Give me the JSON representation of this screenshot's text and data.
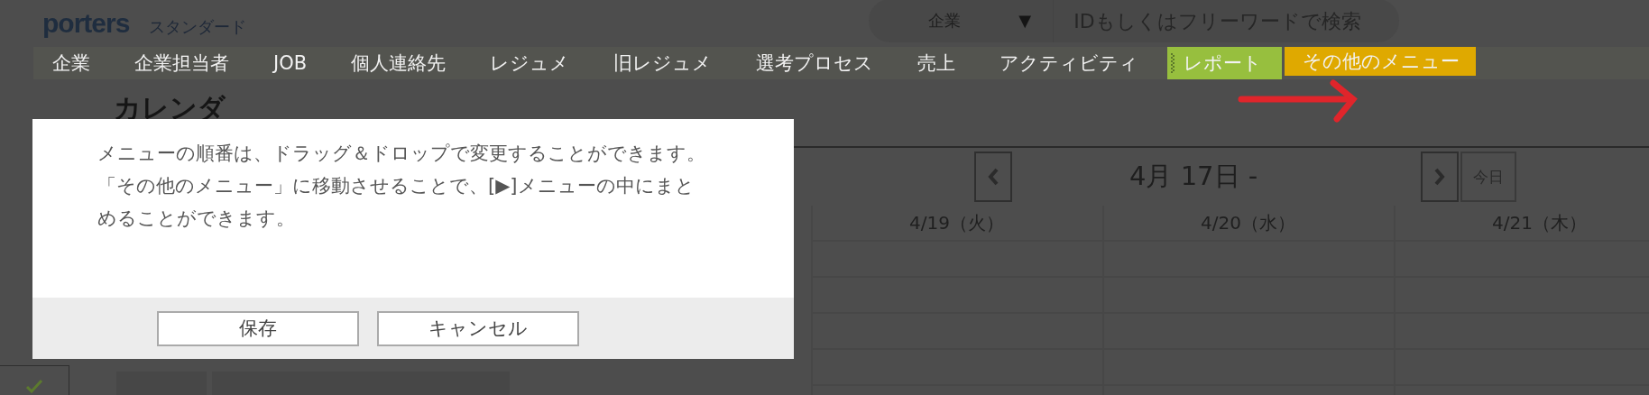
{
  "header": {
    "logo": "porters",
    "edition": "スタンダード",
    "search": {
      "scope": "企業",
      "dropdown_arrow": "▼",
      "placeholder": "IDもしくはフリーワードで検索"
    }
  },
  "nav": [
    {
      "label": "企業",
      "kind": "plain"
    },
    {
      "label": "企業担当者",
      "kind": "plain"
    },
    {
      "label": "JOB",
      "kind": "plain"
    },
    {
      "label": "個人連絡先",
      "kind": "plain"
    },
    {
      "label": "レジュメ",
      "kind": "plain"
    },
    {
      "label": "旧レジュメ",
      "kind": "plain"
    },
    {
      "label": "選考プロセス",
      "kind": "plain"
    },
    {
      "label": "売上",
      "kind": "plain"
    },
    {
      "label": "アクティビティ",
      "kind": "plain"
    },
    {
      "label": "レポート",
      "kind": "dragged"
    },
    {
      "label": "その他のメニュー",
      "kind": "more"
    }
  ],
  "page_title": "カレンダ",
  "calendar": {
    "range": "4月 17日 -",
    "today_button": "今日",
    "days": [
      "4/19（火）",
      "4/20（水）",
      "4/21（木）"
    ]
  },
  "dialog": {
    "message": [
      "メニューの順番は、ドラッグ＆ドロップで変更することができます。",
      "「その他のメニュー」に移動させることで、[▶]メニューの中にまと",
      "めることができます。"
    ],
    "buttons": [
      "保存",
      "キャンセル"
    ]
  }
}
